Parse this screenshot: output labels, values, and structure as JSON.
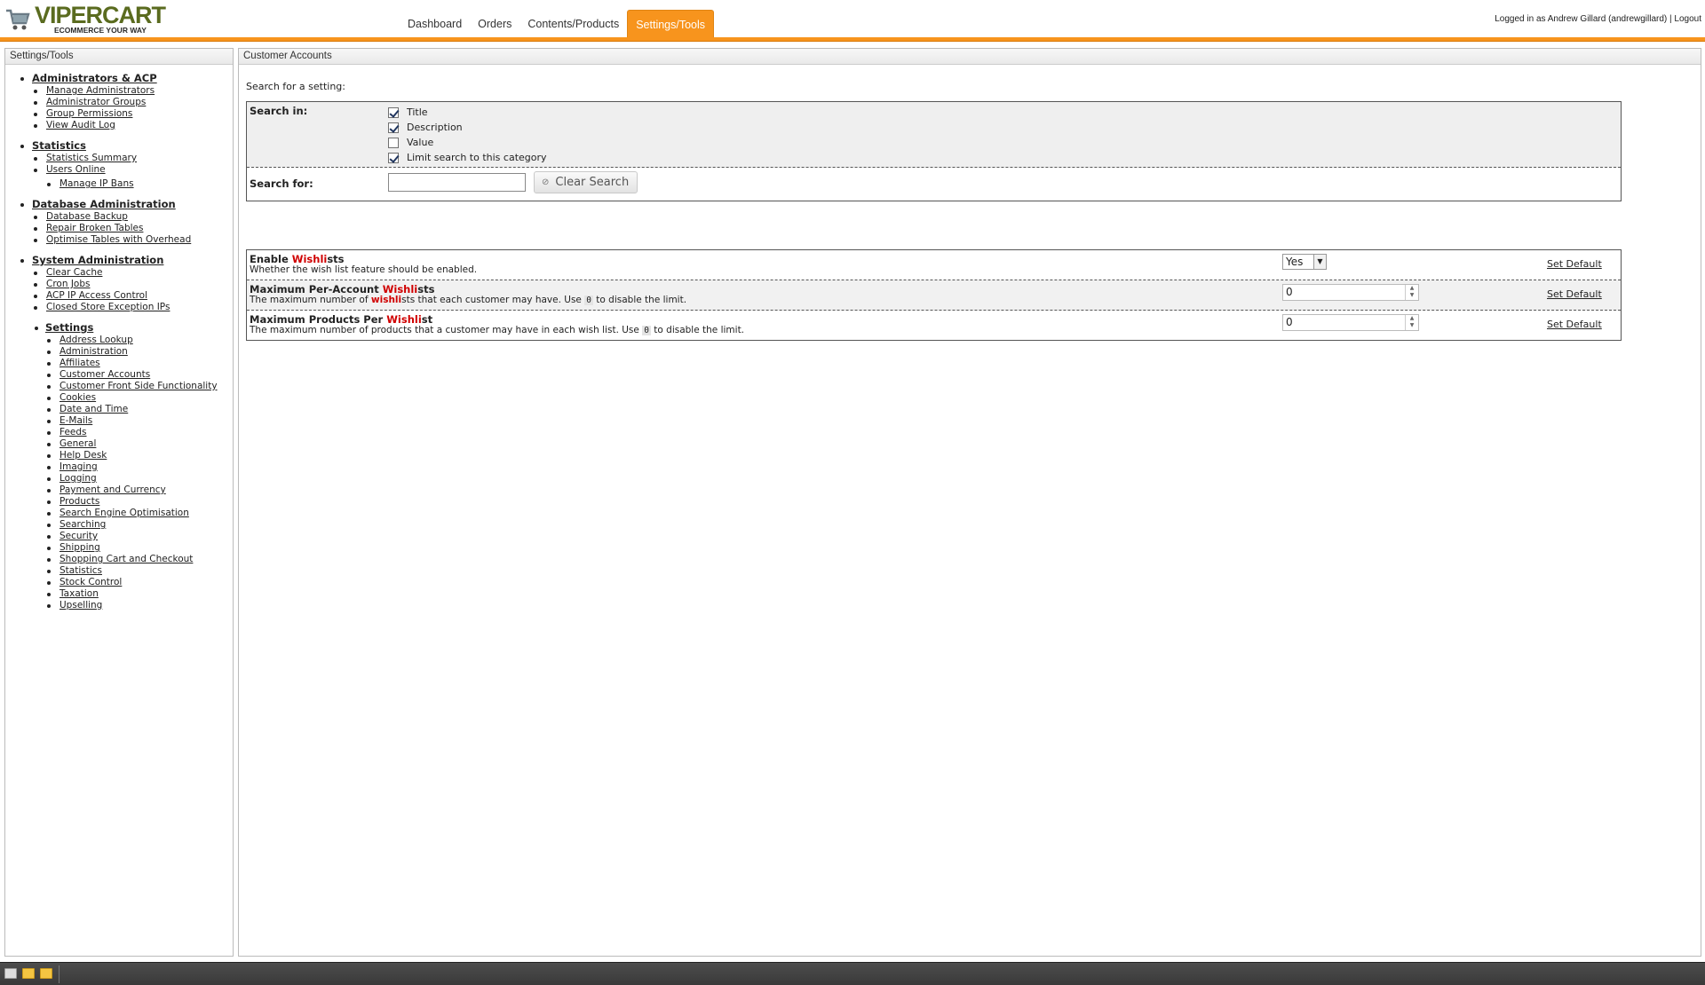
{
  "header": {
    "logo_text": "VIPERCART",
    "logo_tagline": "ECOMMERCE YOUR WAY",
    "nav": [
      {
        "label": "Dashboard"
      },
      {
        "label": "Orders"
      },
      {
        "label": "Contents/Products"
      },
      {
        "label": "Settings/Tools"
      }
    ],
    "active_nav": "Settings/Tools",
    "login_prefix": "Logged in as Andrew Gillard (andrewgillard)",
    "login_sep": " | ",
    "logout_label": "Logout"
  },
  "sidebar": {
    "title": "Settings/Tools",
    "sections": [
      {
        "label": "Administrators & ACP",
        "items": [
          "Manage Administrators",
          "Administrator Groups",
          "Group Permissions",
          "View Audit Log"
        ]
      },
      {
        "label": "Statistics",
        "items": [
          "Statistics Summary",
          "Users Online"
        ],
        "subitems": [
          "Manage IP Bans"
        ]
      },
      {
        "label": "Database Administration",
        "items": [
          "Database Backup",
          "Repair Broken Tables",
          "Optimise Tables with Overhead"
        ]
      },
      {
        "label": "System Administration",
        "items": [
          "Clear Cache",
          "Cron Jobs",
          "ACP IP Access Control",
          "Closed Store Exception IPs"
        ]
      }
    ],
    "settings_section": {
      "label": "Settings",
      "items": [
        "Address Lookup",
        "Administration",
        "Affiliates",
        "Customer Accounts",
        "Customer Front Side Functionality",
        "Cookies",
        "Date and Time",
        "E-Mails",
        "Feeds",
        "General",
        "Help Desk",
        "Imaging",
        "Logging",
        "Payment and Currency",
        "Products",
        "Search Engine Optimisation",
        "Searching",
        "Security",
        "Shipping",
        "Shopping Cart and Checkout",
        "Statistics",
        "Stock Control",
        "Taxation",
        "Upselling"
      ]
    }
  },
  "main": {
    "title": "Customer Accounts",
    "search_prompt": "Search for a setting:",
    "search_in_label": "Search in:",
    "search_options": [
      {
        "label": "Title",
        "checked": true
      },
      {
        "label": "Description",
        "checked": true
      },
      {
        "label": "Value",
        "checked": false
      },
      {
        "label": "Limit search to this category",
        "checked": true
      }
    ],
    "search_for_label": "Search for:",
    "search_value": "",
    "clear_search_label": "Clear Search",
    "settings": [
      {
        "title_pre": "Enable ",
        "title_hl": "Wishli",
        "title_post": "sts",
        "desc_pre": "Whether the wish list feature should be enabled.",
        "control": "select",
        "value": "Yes",
        "set_default": "Set Default"
      },
      {
        "title_pre": "Maximum Per-Account ",
        "title_hl": "Wishli",
        "title_post": "sts",
        "desc_pre": "The maximum number of ",
        "desc_hl": "wishli",
        "desc_mid": "sts that each customer may have. Use ",
        "desc_code": "0",
        "desc_post": " to disable the limit.",
        "control": "number",
        "value": "0",
        "set_default": "Set Default"
      },
      {
        "title_pre": "Maximum Products Per ",
        "title_hl": "Wishli",
        "title_post": "st",
        "desc_pre": "The maximum number of products that a customer may have in each wish list. Use ",
        "desc_code": "0",
        "desc_post": " to disable the limit.",
        "control": "number",
        "value": "0",
        "set_default": "Set Default"
      }
    ]
  },
  "colors": {
    "accent": "#f7941d",
    "highlight": "#d00000",
    "logo_green": "#5a6b1f"
  }
}
